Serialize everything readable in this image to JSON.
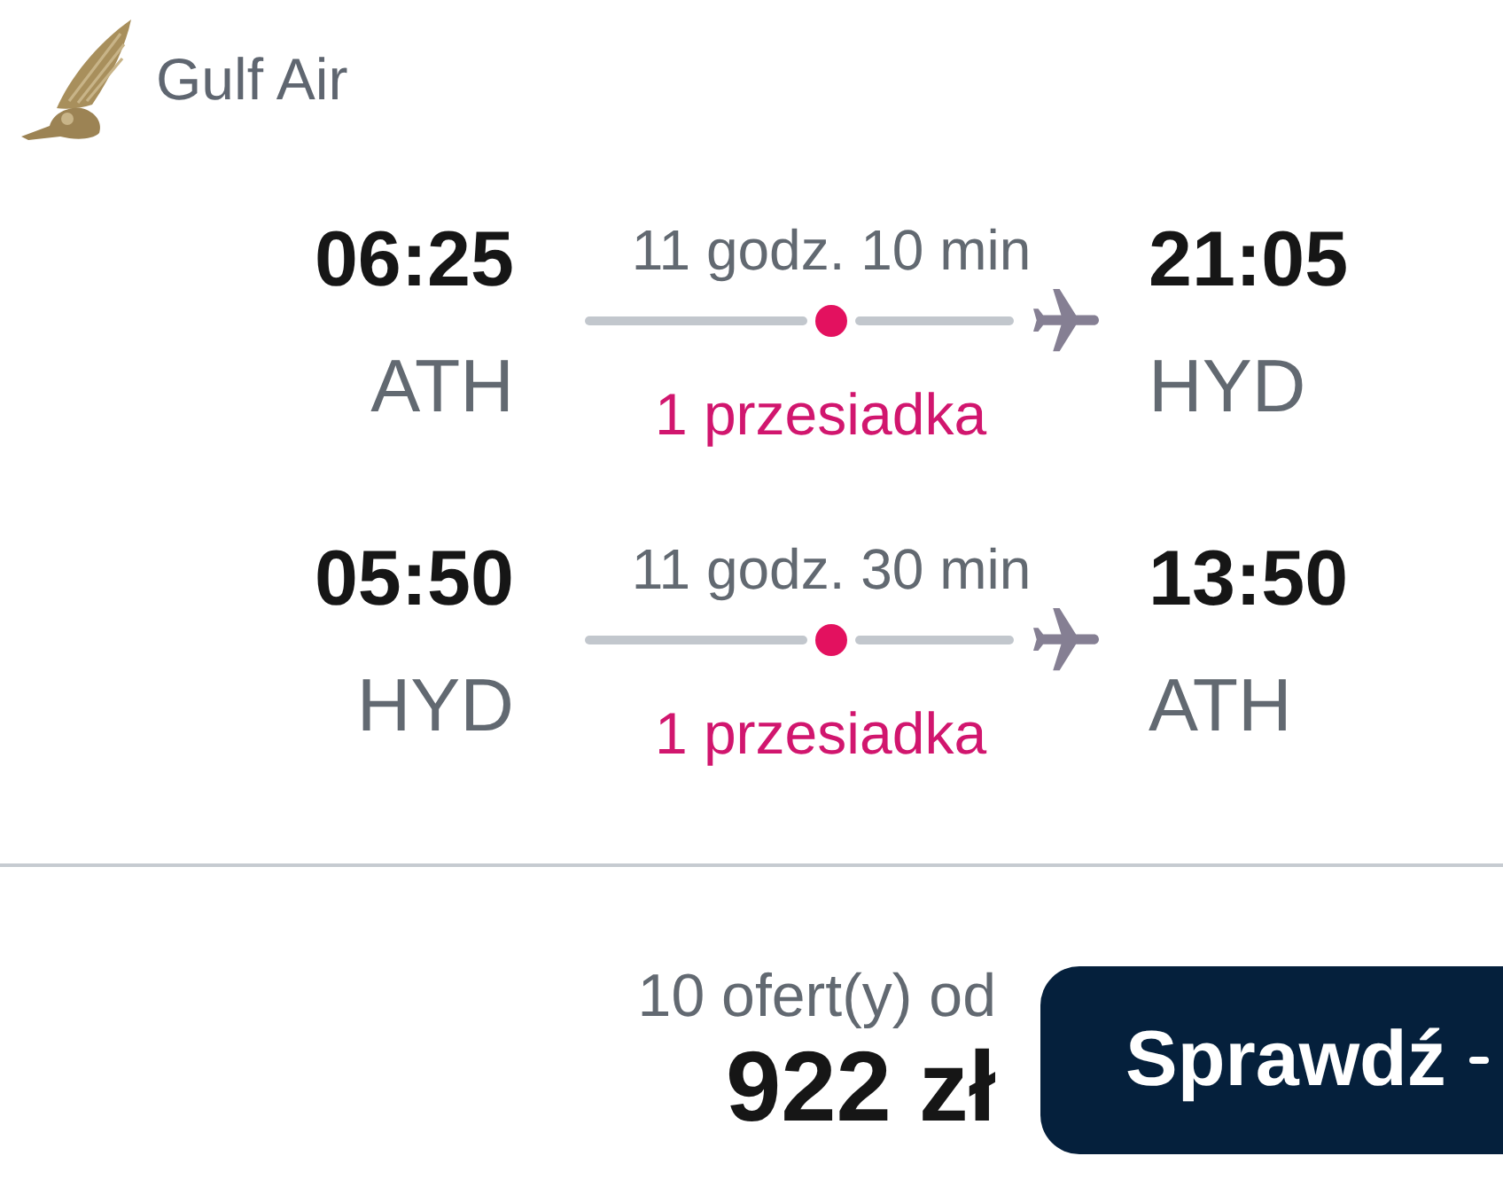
{
  "header": {
    "airline": "Gulf Air"
  },
  "legs": [
    {
      "departure_time": "06:25",
      "departure_airport": "ATH",
      "duration": "11 godz. 10 min",
      "stops": "1 przesiadka",
      "arrival_time": "21:05",
      "arrival_airport": "HYD"
    },
    {
      "departure_time": "05:50",
      "departure_airport": "HYD",
      "duration": "11 godz. 30 min",
      "stops": "1 przesiadka",
      "arrival_time": "13:50",
      "arrival_airport": "ATH"
    }
  ],
  "footer": {
    "offers": "10 ofert(y) od",
    "price": "922 zł",
    "button": "Sprawdź"
  }
}
